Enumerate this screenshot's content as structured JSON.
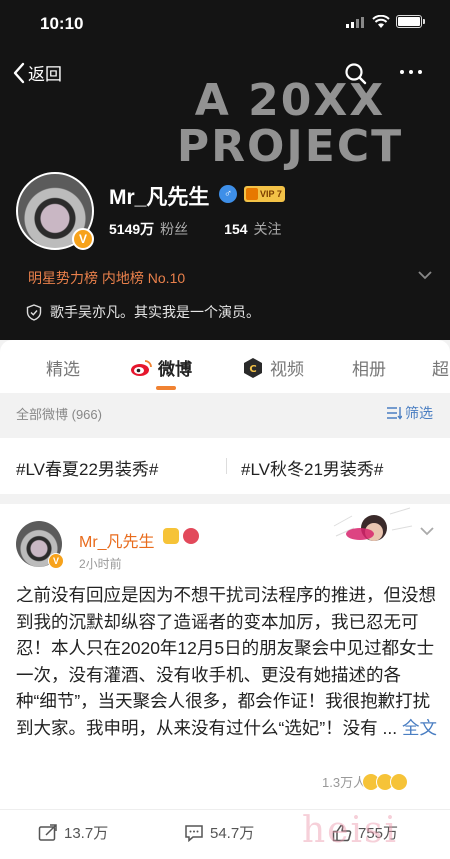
{
  "status_bar": {
    "time": "10:10"
  },
  "nav": {
    "back_label": "返回"
  },
  "banner": {
    "line1": "A 20XX",
    "line2": "PROJECT"
  },
  "profile": {
    "name": "Mr_凡先生",
    "gender_symbol": "♂",
    "vip_label": "VIP 7",
    "verified_mark": "V",
    "followers_count": "5149万",
    "followers_label": "粉丝",
    "following_count": "154",
    "following_label": "关注",
    "rank_text": "明星势力榜 内地榜 No.10",
    "bio": "歌手吴亦凡。其实我是一个演员。"
  },
  "tabs": [
    {
      "label": "精选",
      "active": false
    },
    {
      "label": "微博",
      "active": true
    },
    {
      "label": "视频",
      "active": false
    },
    {
      "label": "相册",
      "active": false
    },
    {
      "label": "超",
      "active": false
    }
  ],
  "feed": {
    "all_count": "全部微博 (966)",
    "filter_label": "筛选"
  },
  "hashtags": [
    "#LV春夏22男装秀#",
    "#LV秋冬21男装秀#"
  ],
  "post": {
    "author": "Mr_凡先生",
    "time": "2小时前",
    "text": "之前没有回应是因为不想干扰司法程序的推进，但没想到我的沉默却纵容了造谣者的变本加厉，我已忍无可忍！本人只在2020年12月5日的朋友聚会中见过都女士一次，没有灌酒、没有收手机、更没有她描述的各种“细节”，当天聚会人很多，都会作证！我很抱歉打扰到大家。我申明，从来没有过什么“选妃”！没有 ...",
    "more_label": "全文",
    "reaction_summary": "1.3万人",
    "reposts": "13.7万",
    "comments": "54.7万",
    "likes": "755万"
  },
  "colors": {
    "accent_orange": "#f08232",
    "link_blue": "#4a7ec2",
    "header_bg": "#141414"
  }
}
